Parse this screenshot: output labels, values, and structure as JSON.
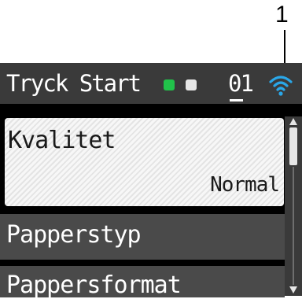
{
  "callout": {
    "number": "1"
  },
  "status_bar": {
    "title": "Tryck Start",
    "job_number": "01",
    "icons": [
      "green-led-icon",
      "white-led-icon",
      "wifi-icon"
    ],
    "colors": {
      "green_led": "#21c24a",
      "wifi": "#2aa7e8"
    }
  },
  "menu": {
    "items": [
      {
        "label": "Kvalitet",
        "value": "Normal",
        "selected": true
      },
      {
        "label": "Papperstyp"
      },
      {
        "label": "Pappersformat"
      }
    ]
  }
}
